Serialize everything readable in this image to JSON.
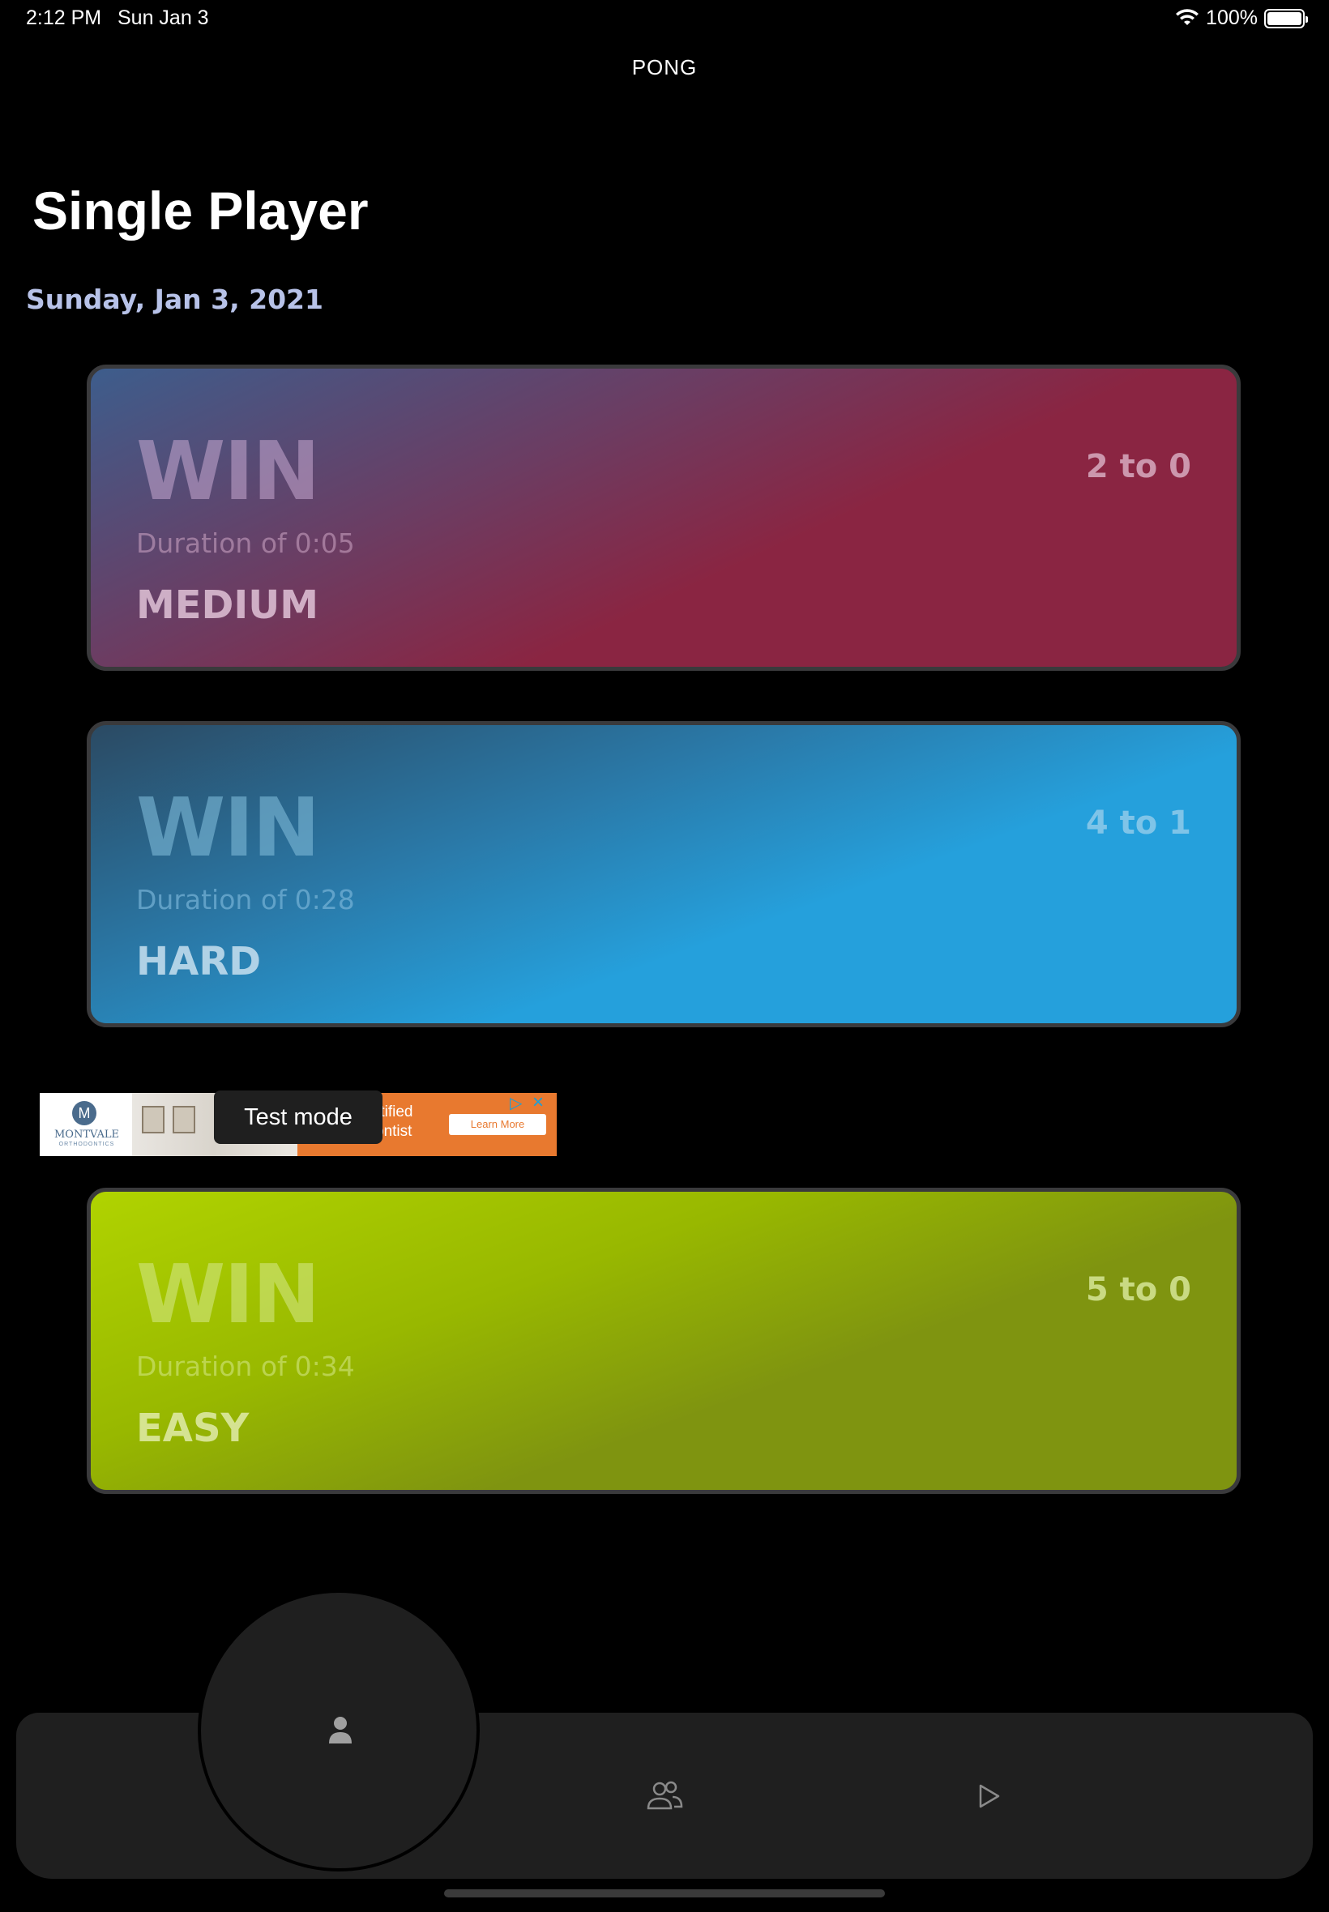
{
  "status_bar": {
    "time": "2:12 PM",
    "date": "Sun Jan 3",
    "battery": "100%",
    "icons": [
      "wifi-icon",
      "battery-icon"
    ]
  },
  "nav": {
    "title": "PONG"
  },
  "page": {
    "title": "Single Player",
    "date": "Sunday, Jan 3, 2021"
  },
  "games": [
    {
      "result": "WIN",
      "duration_label": "Duration of",
      "duration": "0:05",
      "level": "MEDIUM",
      "score": "2 to 0",
      "color": "#8a2542"
    },
    {
      "result": "WIN",
      "duration_label": "Duration of",
      "duration": "0:28",
      "level": "HARD",
      "score": "4 to 1",
      "color": "#25a0dc"
    },
    {
      "result": "WIN",
      "duration_label": "Duration of",
      "duration": "0:34",
      "level": "EASY",
      "score": "5 to 0",
      "color": "#7f9410"
    }
  ],
  "ad": {
    "brand": "MONTVALE",
    "brand_sub": "ORTHODONTICS",
    "text_line1": "rtified",
    "text_line2": "ontist",
    "cta": "Learn More",
    "overlay": "Test mode",
    "accent": "#e8792f"
  },
  "tab_bar": {
    "tabs": [
      {
        "name": "single-player",
        "icon": "person-icon",
        "selected": true
      },
      {
        "name": "multiplayer",
        "icon": "people-icon",
        "selected": false
      },
      {
        "name": "play",
        "icon": "play-icon",
        "selected": false
      }
    ]
  }
}
